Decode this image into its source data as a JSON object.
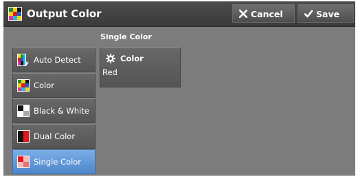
{
  "titlebar": {
    "title": "Output Color",
    "cancel_label": "Cancel",
    "save_label": "Save"
  },
  "section": {
    "label": "Single Color"
  },
  "color_options": [
    {
      "label": "Auto Detect",
      "icon": "auto-detect-icon"
    },
    {
      "label": "Color",
      "icon": "color-icon"
    },
    {
      "label": "Black & White",
      "icon": "black-white-icon"
    },
    {
      "label": "Dual Color",
      "icon": "dual-color-icon"
    },
    {
      "label": "Single Color",
      "icon": "single-color-icon",
      "selected": true
    }
  ],
  "color_setting": {
    "heading": "Color",
    "value": "Red",
    "icon": "gear-icon"
  },
  "colors": {
    "background": "#7c7c7c",
    "titlebar": "#3f3f3f",
    "selected": "#5f97d9",
    "red": "#e4161b"
  }
}
